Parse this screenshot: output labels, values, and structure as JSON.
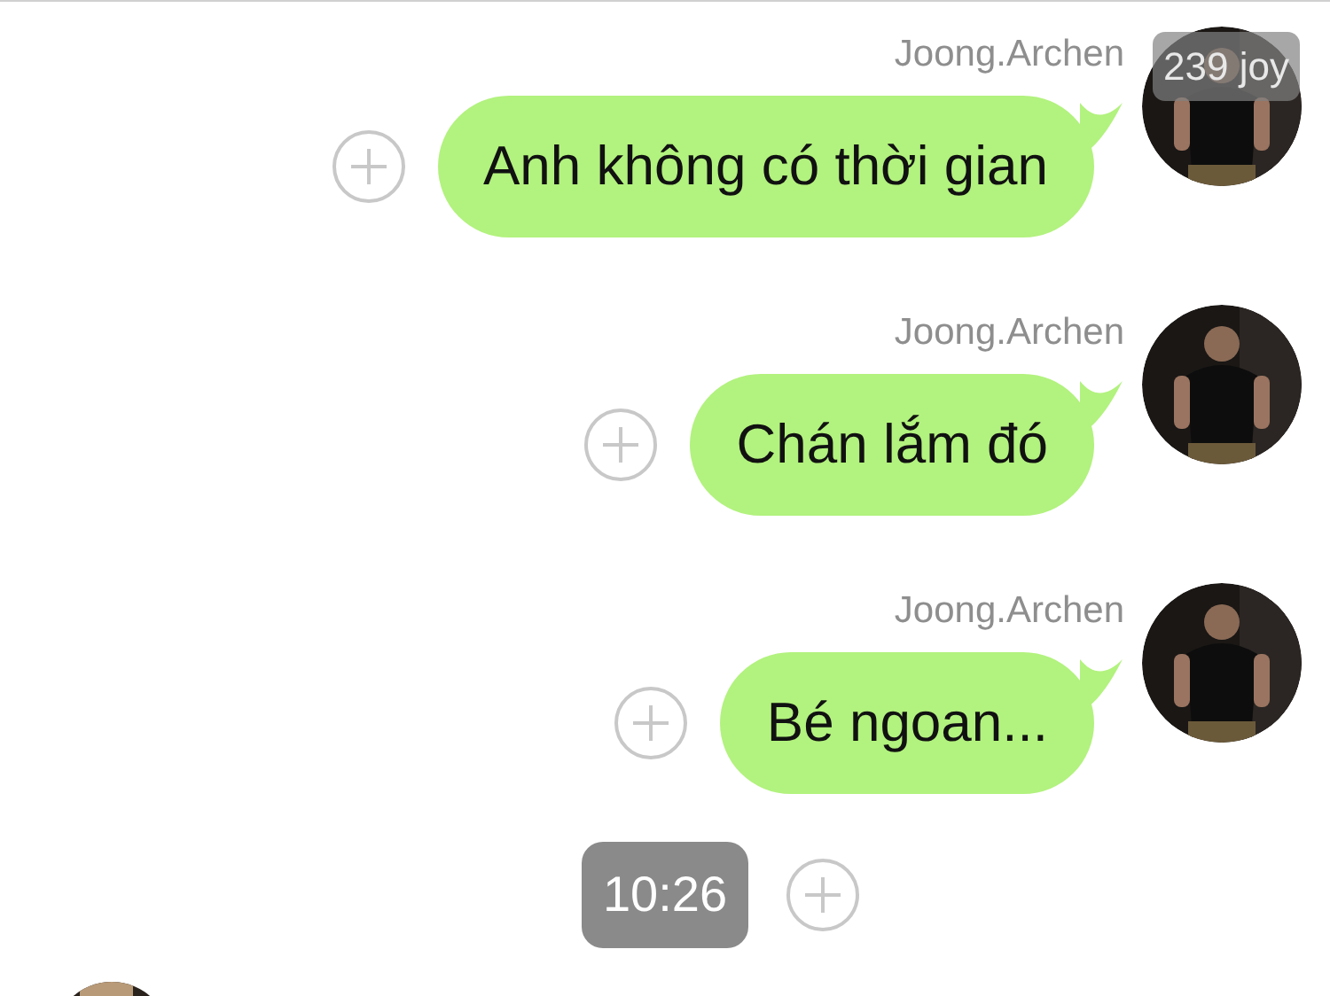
{
  "messages": [
    {
      "sender": "Joong.Archen",
      "text": "Anh không có thời gian"
    },
    {
      "sender": "Joong.Archen",
      "text": "Chán lắm đó"
    },
    {
      "sender": "Joong.Archen",
      "text": "Bé ngoan..."
    }
  ],
  "viewer_badge": "239 joy",
  "timestamp": "10:26"
}
